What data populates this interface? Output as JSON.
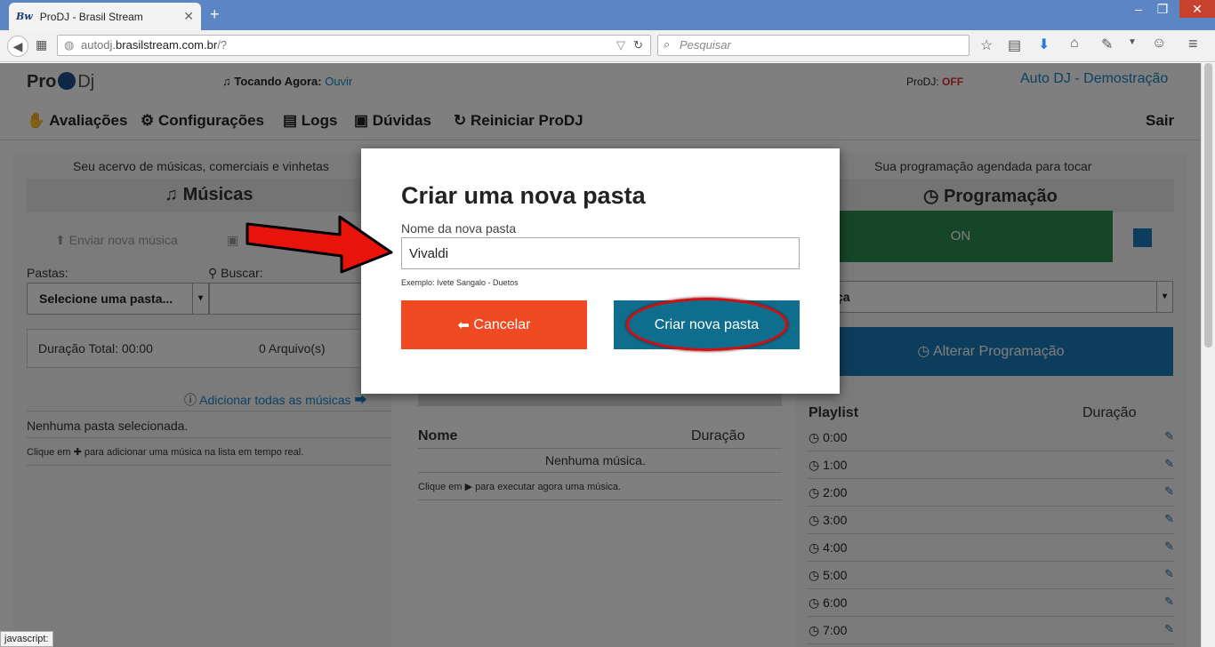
{
  "browser": {
    "tab_title": "ProDJ - Brasil Stream",
    "tab_favicon": "Bw",
    "url_host": "autodj.",
    "url_domain": "brasilstream.com.br",
    "url_path": "/?",
    "search_placeholder": "Pesquisar",
    "status_text": "javascript:"
  },
  "header": {
    "logo_pro": "Pro",
    "logo_dj": "Dj",
    "now_playing_label": "Tocando Agora:",
    "now_playing_link": "Ouvir",
    "prodj_label": "ProDJ:",
    "prodj_status": "OFF",
    "site_title": "Auto DJ - Demostração"
  },
  "nav": {
    "items": [
      "Avaliações",
      "Configurações",
      "Logs",
      "Dúvidas",
      "Reiniciar ProDJ"
    ],
    "logout": "Sair"
  },
  "left_panel": {
    "caption": "Seu acervo de músicas, comerciais e vinhetas",
    "title": "Músicas",
    "upload": "Enviar nova música",
    "folders_label": "Pastas:",
    "search_label": "Buscar:",
    "folder_select": "Selecione uma pasta...",
    "total_duration": "Duração Total: 00:00",
    "files_count": "0 Arquivo(s)",
    "add_all": "Adicionar todas as músicas",
    "no_folder": "Nenhuma pasta selecionada.",
    "hint_prefix": "Clique em",
    "hint_suffix": "para adicionar uma música na lista em tempo real."
  },
  "middle_panel": {
    "col_name": "Nome",
    "col_duration": "Duração",
    "empty": "Nenhuma música.",
    "hint_prefix": "Clique em",
    "hint_suffix": "para executar agora uma música."
  },
  "right_panel": {
    "caption": "Sua programação agendada para tocar",
    "title": "Programação",
    "on_label": "ON",
    "select_value": "ça",
    "change_button": "Alterar Programação",
    "playlist_label": "Playlist",
    "duration_label": "Duração",
    "times": [
      "0:00",
      "1:00",
      "2:00",
      "3:00",
      "4:00",
      "5:00",
      "6:00",
      "7:00"
    ]
  },
  "modal": {
    "title": "Criar uma nova pasta",
    "field_label": "Nome da nova pasta",
    "field_value": "Vivaldi",
    "example": "Exemplo: Ivete Sangalo - Duetos",
    "cancel_label": "Cancelar",
    "create_label": "Criar nova pasta"
  },
  "colors": {
    "cancel": "#f04a23",
    "create": "#0f6e8e",
    "on_green": "#2f8a4e",
    "link_blue": "#1a82c4",
    "annotation_red": "#d01010"
  }
}
